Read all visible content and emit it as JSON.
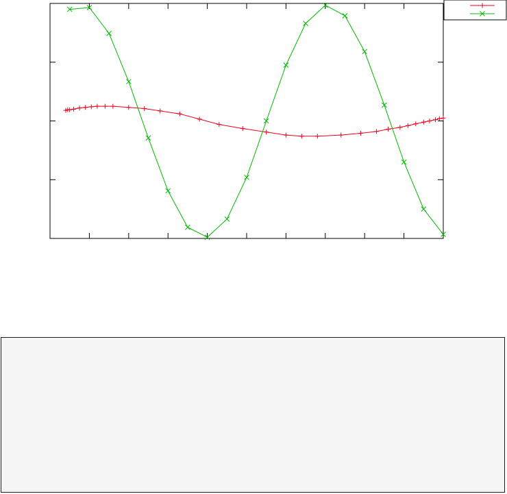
{
  "chart_data": {
    "type": "line",
    "title": "",
    "xlabel": "",
    "ylabel": "",
    "xlim": [
      0,
      1
    ],
    "ylim": [
      -2,
      2
    ],
    "grid": false,
    "legend_position": "top-right",
    "tick_labels_visible": false,
    "series": [
      {
        "color": "#e8001a",
        "marker": "plus",
        "x": [
          0.04,
          0.045,
          0.05,
          0.06,
          0.075,
          0.09,
          0.105,
          0.12,
          0.14,
          0.16,
          0.2,
          0.24,
          0.28,
          0.33,
          0.38,
          0.43,
          0.49,
          0.55,
          0.6,
          0.64,
          0.68,
          0.74,
          0.79,
          0.83,
          0.86,
          0.89,
          0.91,
          0.93,
          0.95,
          0.965,
          0.98,
          0.99,
          1.0
        ],
        "values": [
          0.18,
          0.19,
          0.19,
          0.2,
          0.22,
          0.23,
          0.24,
          0.25,
          0.25,
          0.25,
          0.23,
          0.21,
          0.17,
          0.12,
          0.03,
          -0.06,
          -0.13,
          -0.19,
          -0.24,
          -0.26,
          -0.26,
          -0.24,
          -0.21,
          -0.18,
          -0.14,
          -0.11,
          -0.08,
          -0.05,
          -0.02,
          0.0,
          0.02,
          0.04,
          0.05
        ]
      },
      {
        "color": "#00b800",
        "marker": "cross",
        "x": [
          0.05,
          0.1,
          0.15,
          0.2,
          0.25,
          0.3,
          0.35,
          0.4,
          0.45,
          0.5,
          0.55,
          0.6,
          0.65,
          0.7,
          0.75,
          0.8,
          0.85,
          0.9,
          0.95,
          1.0
        ],
        "values": [
          1.9,
          1.93,
          1.49,
          0.67,
          -0.29,
          -1.19,
          -1.81,
          -1.98,
          -1.67,
          -0.96,
          0.0,
          0.95,
          1.66,
          1.97,
          1.79,
          1.18,
          0.27,
          -0.7,
          -1.5,
          -1.93
        ]
      }
    ]
  },
  "text_panel": {
    "content": ""
  }
}
